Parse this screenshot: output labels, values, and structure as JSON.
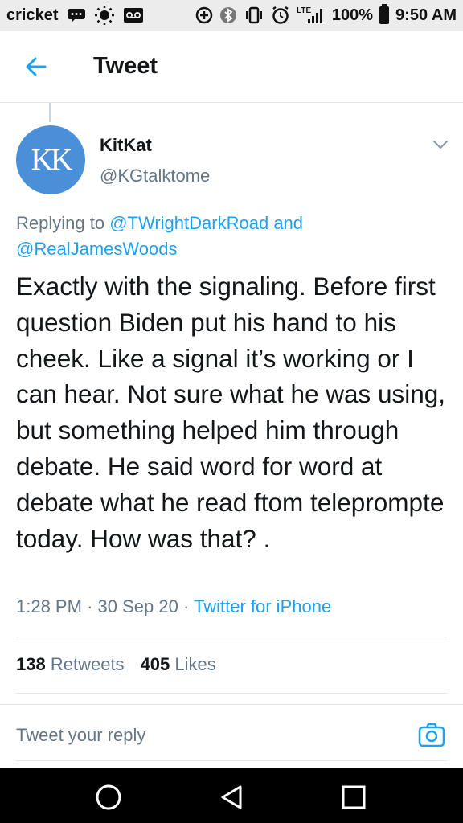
{
  "status_bar": {
    "carrier": "cricket",
    "network": "LTE",
    "battery": "100%",
    "time": "9:50 AM"
  },
  "header": {
    "title": "Tweet"
  },
  "tweet": {
    "author_initials": "KK",
    "author_name": "KitKat",
    "author_handle": "@KGtalktome",
    "replying_prefix": "Replying to",
    "mention_1": "@TWrightDarkRoad",
    "conjunction": "and",
    "mention_2": "@RealJamesWoods",
    "text": "Exactly with the signaling. Before first question Biden put  his hand to his cheek. Like a signal it’s working or I can hear. Not sure what he was using, but something helped him through debate. He said word for word at debate what he read ftom teleprompte today. How was that? .",
    "time": "1:28 PM",
    "date": "30 Sep 20",
    "source": "Twitter for iPhone",
    "separator": "·",
    "retweets_count": "138",
    "retweets_label": "Retweets",
    "likes_count": "405",
    "likes_label": "Likes"
  },
  "reply": {
    "placeholder": "Tweet your reply"
  },
  "icons": {
    "back": "arrow-left-icon",
    "caret": "chevron-down-icon",
    "camera": "camera-icon",
    "nav_home": "home-circle-icon",
    "nav_back": "triangle-back-icon",
    "nav_recent": "square-recents-icon"
  },
  "colors": {
    "accent": "#1da1f2",
    "muted": "#657786",
    "avatar": "#4a90d9"
  }
}
